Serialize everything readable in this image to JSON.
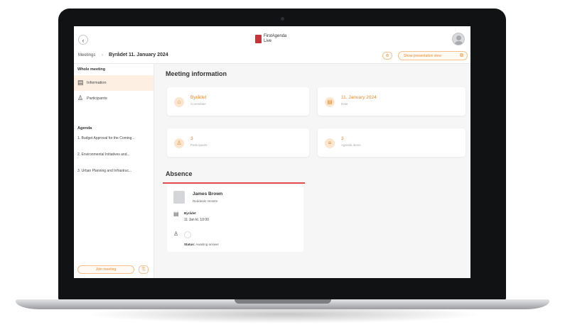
{
  "header": {
    "back_icon": "chevron-left-icon",
    "logo_line1": "FirstAgenda",
    "logo_line2": "Live",
    "brand_color": "#c9323a",
    "accent_color": "#e98a2b"
  },
  "breadcrumb": {
    "root": "Meetings",
    "separator": "›",
    "current": "Byrådet 11. January 2024",
    "small_button": "⊘",
    "presentation_button": "Show presentation view"
  },
  "sidebar": {
    "section_whole": "Whole meeting",
    "items": [
      {
        "label": "Information",
        "icon": "calendar-icon"
      },
      {
        "label": "Participants",
        "icon": "people-icon"
      }
    ],
    "section_agenda": "Agenda",
    "agenda": [
      "1. Budget Approval for the Coming...",
      "2. Environmental Initiatives and...",
      "3. Urban Planning and Infrastruc..."
    ],
    "join_label": "Join meeting"
  },
  "main": {
    "title": "Meeting information",
    "cards": [
      {
        "value": "Byrådet",
        "label": "Committee",
        "icon": "building-icon"
      },
      {
        "value": "11. January 2024",
        "label": "Date",
        "icon": "calendar-icon"
      },
      {
        "value": "3",
        "label": "Participants",
        "icon": "people-icon"
      },
      {
        "value": "3",
        "label": "Agenda items",
        "icon": "list-icon"
      }
    ],
    "absence_title": "Absence",
    "absence": {
      "name": "James Brown",
      "role": "Reddeals Venstre",
      "committee_label": "Byrådet",
      "date": "11 Jan kl. 10:00",
      "status_label": "Status:",
      "status_value": "Awaiting answer"
    }
  }
}
